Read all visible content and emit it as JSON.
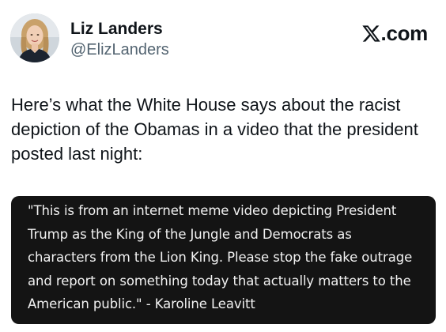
{
  "author": {
    "name": "Liz Landers",
    "handle": "@ElizLanders",
    "avatar_icon": "profile-photo"
  },
  "brand": {
    "logo_icon": "x-logo-icon",
    "text": ".com"
  },
  "tweet": {
    "text": "Here’s what the White House says about the racist depiction of the Obamas in a video that the president posted last night:"
  },
  "quote": {
    "text": "\"This is from an internet meme video depicting President Trump as the King of the Jungle and Democrats as characters from the Lion King. Please stop the fake outrage and report on something today that actually matters to the American public.\" - Karoline Leavitt",
    "background": "#141414",
    "color": "#f2f2f2"
  }
}
